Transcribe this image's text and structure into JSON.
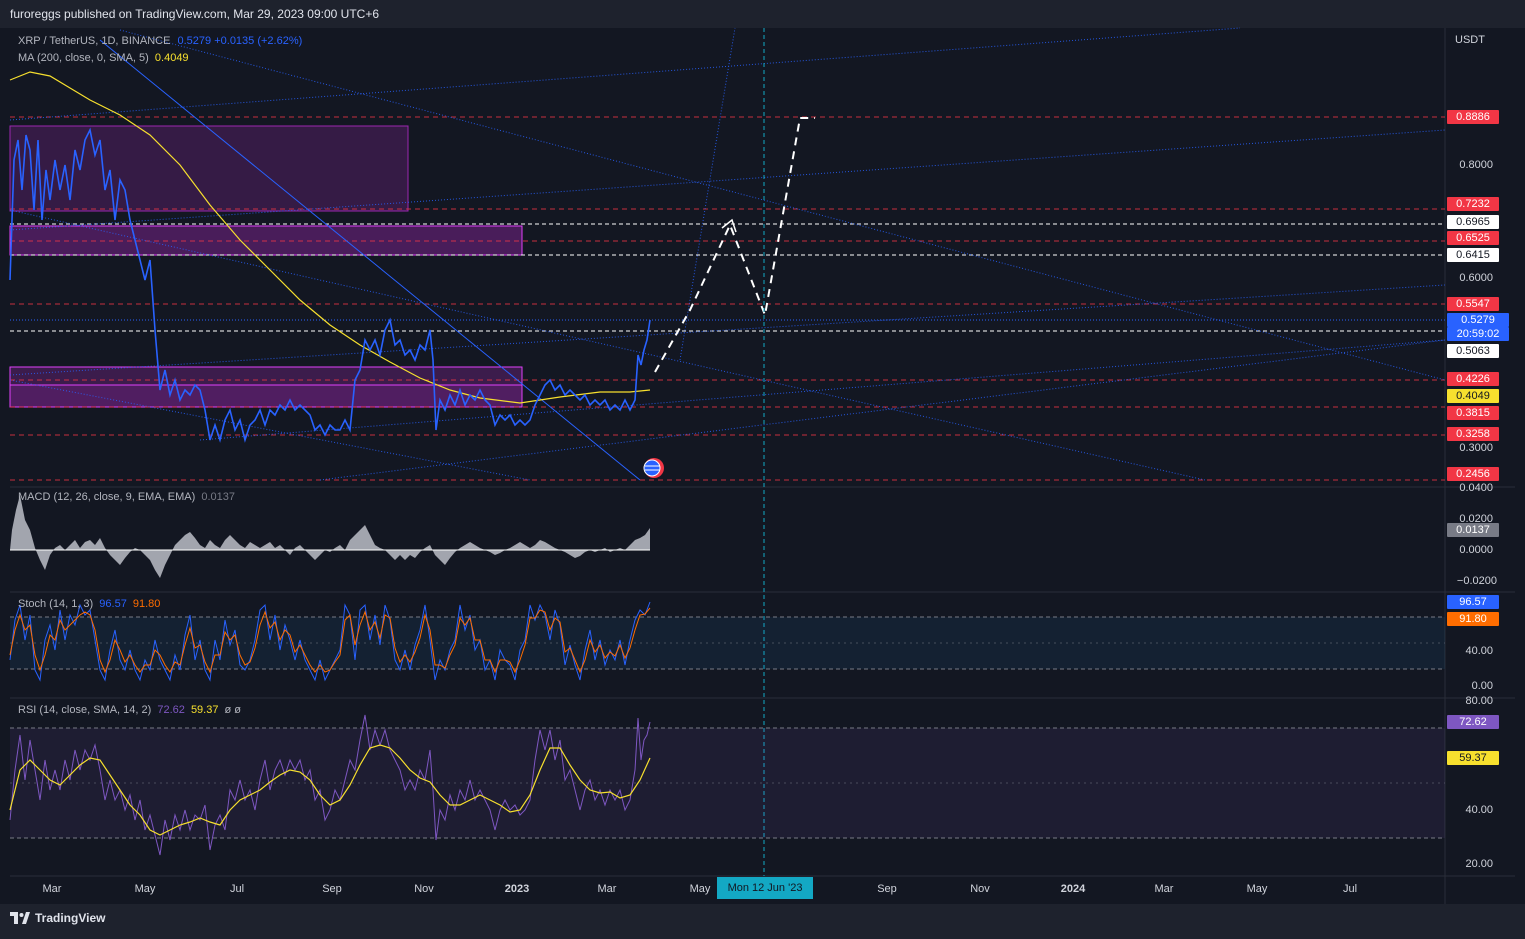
{
  "header": {
    "publisher": "furoreggs published on TradingView.com, Mar 29, 2023 09:00 UTC+6"
  },
  "footer": {
    "brand": "TradingView"
  },
  "main_legend": {
    "symbol": "XRP / TetherUS, 1D, BINANCE",
    "price": "0.5279",
    "change": "+0.0135 (+2.62%)",
    "ma_label": "MA (200, close, 0, SMA, 5)",
    "ma_value": "0.4049"
  },
  "price_axis": {
    "currency": "USDT",
    "ticks": [
      "0.8000",
      "0.6000",
      "0.3000",
      "0.0400"
    ],
    "tags": [
      {
        "text": "0.8886",
        "color": "#f23645"
      },
      {
        "text": "0.7232",
        "color": "#f23645"
      },
      {
        "text": "0.6965",
        "color": "#ffffff"
      },
      {
        "text": "0.6525",
        "color": "#f23645"
      },
      {
        "text": "0.6415",
        "color": "#ffffff"
      },
      {
        "text": "0.5547",
        "color": "#f23645"
      },
      {
        "text": "0.5279",
        "color": "#2962ff"
      },
      {
        "text": "20:59:02",
        "color": "#2962ff"
      },
      {
        "text": "0.5063",
        "color": "#ffffff"
      },
      {
        "text": "0.4226",
        "color": "#f23645"
      },
      {
        "text": "0.4049",
        "color": "#f7e02e"
      },
      {
        "text": "0.3815",
        "color": "#f23645"
      },
      {
        "text": "0.3258",
        "color": "#f23645"
      },
      {
        "text": "0.2456",
        "color": "#f23645"
      }
    ]
  },
  "macd": {
    "label": "MACD (12, 26, close, 9, EMA, EMA)",
    "value": "0.0137",
    "ticks": [
      "0.0200",
      "0.0000",
      "−0.0200"
    ],
    "tag": "0.0137"
  },
  "stoch": {
    "label": "Stoch (14, 1, 3)",
    "k": "96.57",
    "d": "91.80",
    "ticks": [
      "40.00",
      "0.00"
    ],
    "tag_k": "96.57",
    "tag_d": "91.80"
  },
  "rsi": {
    "label": "RSI (14, close, SMA, 14, 2)",
    "rsi": "72.62",
    "ma": "59.37",
    "extra": "ø ø",
    "ticks": [
      "80.00",
      "40.00",
      "20.00"
    ],
    "tag_rsi": "72.62",
    "tag_ma": "59.37"
  },
  "time_axis": {
    "labels": [
      "Mar",
      "May",
      "Jul",
      "Sep",
      "Nov",
      "2023",
      "Mar",
      "May",
      "Sep",
      "Nov",
      "2024",
      "Mar",
      "May",
      "Jul"
    ],
    "selected": "Mon 12 Jun '23"
  },
  "colors": {
    "price": "#2962ff",
    "ma": "#f7e02e",
    "stoch_d": "#ff6d00",
    "rsi": "#7e57c2",
    "zone": "#9c27b0",
    "red_level": "#f23645"
  }
}
